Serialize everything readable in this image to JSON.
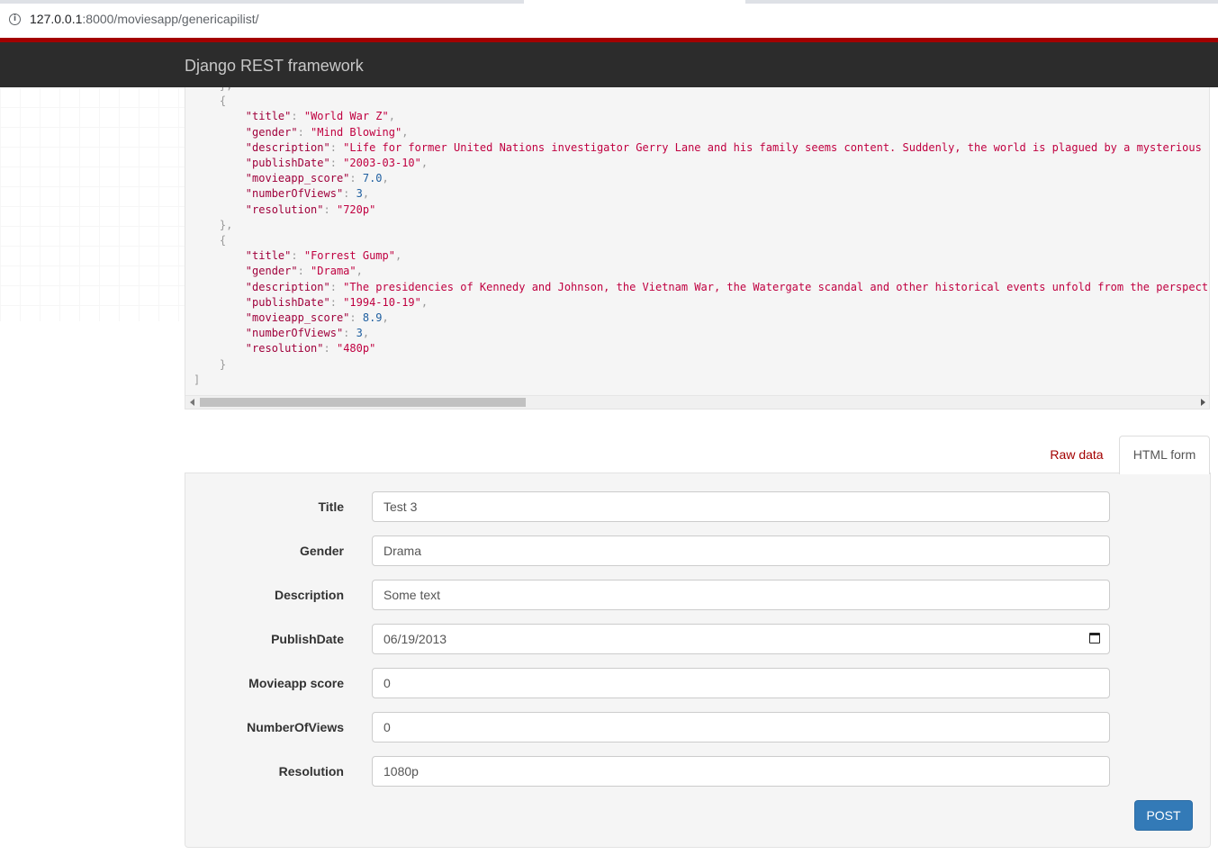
{
  "browser": {
    "url_host": "127.0.0.1",
    "url_path": ":8000/moviesapp/genericapilist/"
  },
  "navbar": {
    "brand": "Django REST framework"
  },
  "response": {
    "items": [
      {
        "title": "World War Z",
        "gender": "Mind Blowing",
        "description": "Life for former United Nations investigator Gerry Lane and his family seems content. Suddenly, the world is plagued by a mysterious i",
        "publishDate": "2003-03-10",
        "movieapp_score": "7.0",
        "numberOfViews": "3",
        "resolution": "720p"
      },
      {
        "title": "Forrest Gump",
        "gender": "Drama",
        "description": "The presidencies of Kennedy and Johnson, the Vietnam War, the Watergate scandal and other historical events unfold from the perspecti",
        "publishDate": "1994-10-19",
        "movieapp_score": "8.9",
        "numberOfViews": "3",
        "resolution": "480p"
      }
    ]
  },
  "tabs": {
    "raw": "Raw data",
    "html_form": "HTML form"
  },
  "form": {
    "fields": {
      "title": {
        "label": "Title",
        "value": "Test 3"
      },
      "gender": {
        "label": "Gender",
        "value": "Drama"
      },
      "description": {
        "label": "Description",
        "value": "Some text"
      },
      "publishDate": {
        "label": "PublishDate",
        "value": "06/19/2013"
      },
      "movieapp_score": {
        "label": "Movieapp score",
        "value": "0"
      },
      "numberOfViews": {
        "label": "NumberOfViews",
        "value": "0"
      },
      "resolution": {
        "label": "Resolution",
        "value": "1080p"
      }
    },
    "submit_label": "POST"
  }
}
